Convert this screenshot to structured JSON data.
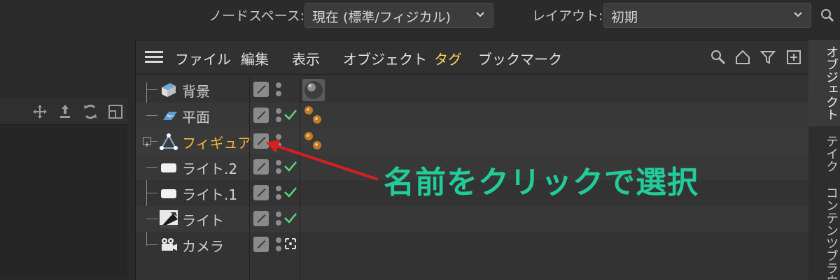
{
  "topbar": {
    "node_space_label": "ノードスペース:",
    "node_space_value": "現在 (標準/フィジカル)",
    "layout_label": "レイアウト:",
    "layout_value": "初期"
  },
  "menubar": {
    "items": [
      "ファイル",
      "編集",
      "表示",
      "オブジェクト",
      "タグ",
      "ブックマーク"
    ]
  },
  "objects": [
    {
      "name": "背景",
      "icon": "background-icon",
      "check": false,
      "tag": "material"
    },
    {
      "name": "平面",
      "icon": "plane-icon",
      "check": true,
      "tag": "balls"
    },
    {
      "name": "フィギュア",
      "icon": "figure-icon",
      "check": false,
      "tag": "balls",
      "selected": true
    },
    {
      "name": "ライト.2",
      "icon": "area-light-icon",
      "check": true,
      "tag": ""
    },
    {
      "name": "ライト.1",
      "icon": "area-light-icon",
      "check": true,
      "tag": ""
    },
    {
      "name": "ライト",
      "icon": "spot-light-icon",
      "check": true,
      "tag": ""
    },
    {
      "name": "カメラ",
      "icon": "camera-icon",
      "check": false,
      "tag": ""
    }
  ],
  "side_tabs": [
    "オブジェクト",
    "テイク",
    "コンテンツブラウザ"
  ],
  "annotation": {
    "text": "名前をクリックで選択",
    "color": "#22cc9a",
    "arrow_color": "#d42020"
  },
  "colors": {
    "active_tab": "#f4d35e",
    "selected_object": "#f4b63a"
  }
}
